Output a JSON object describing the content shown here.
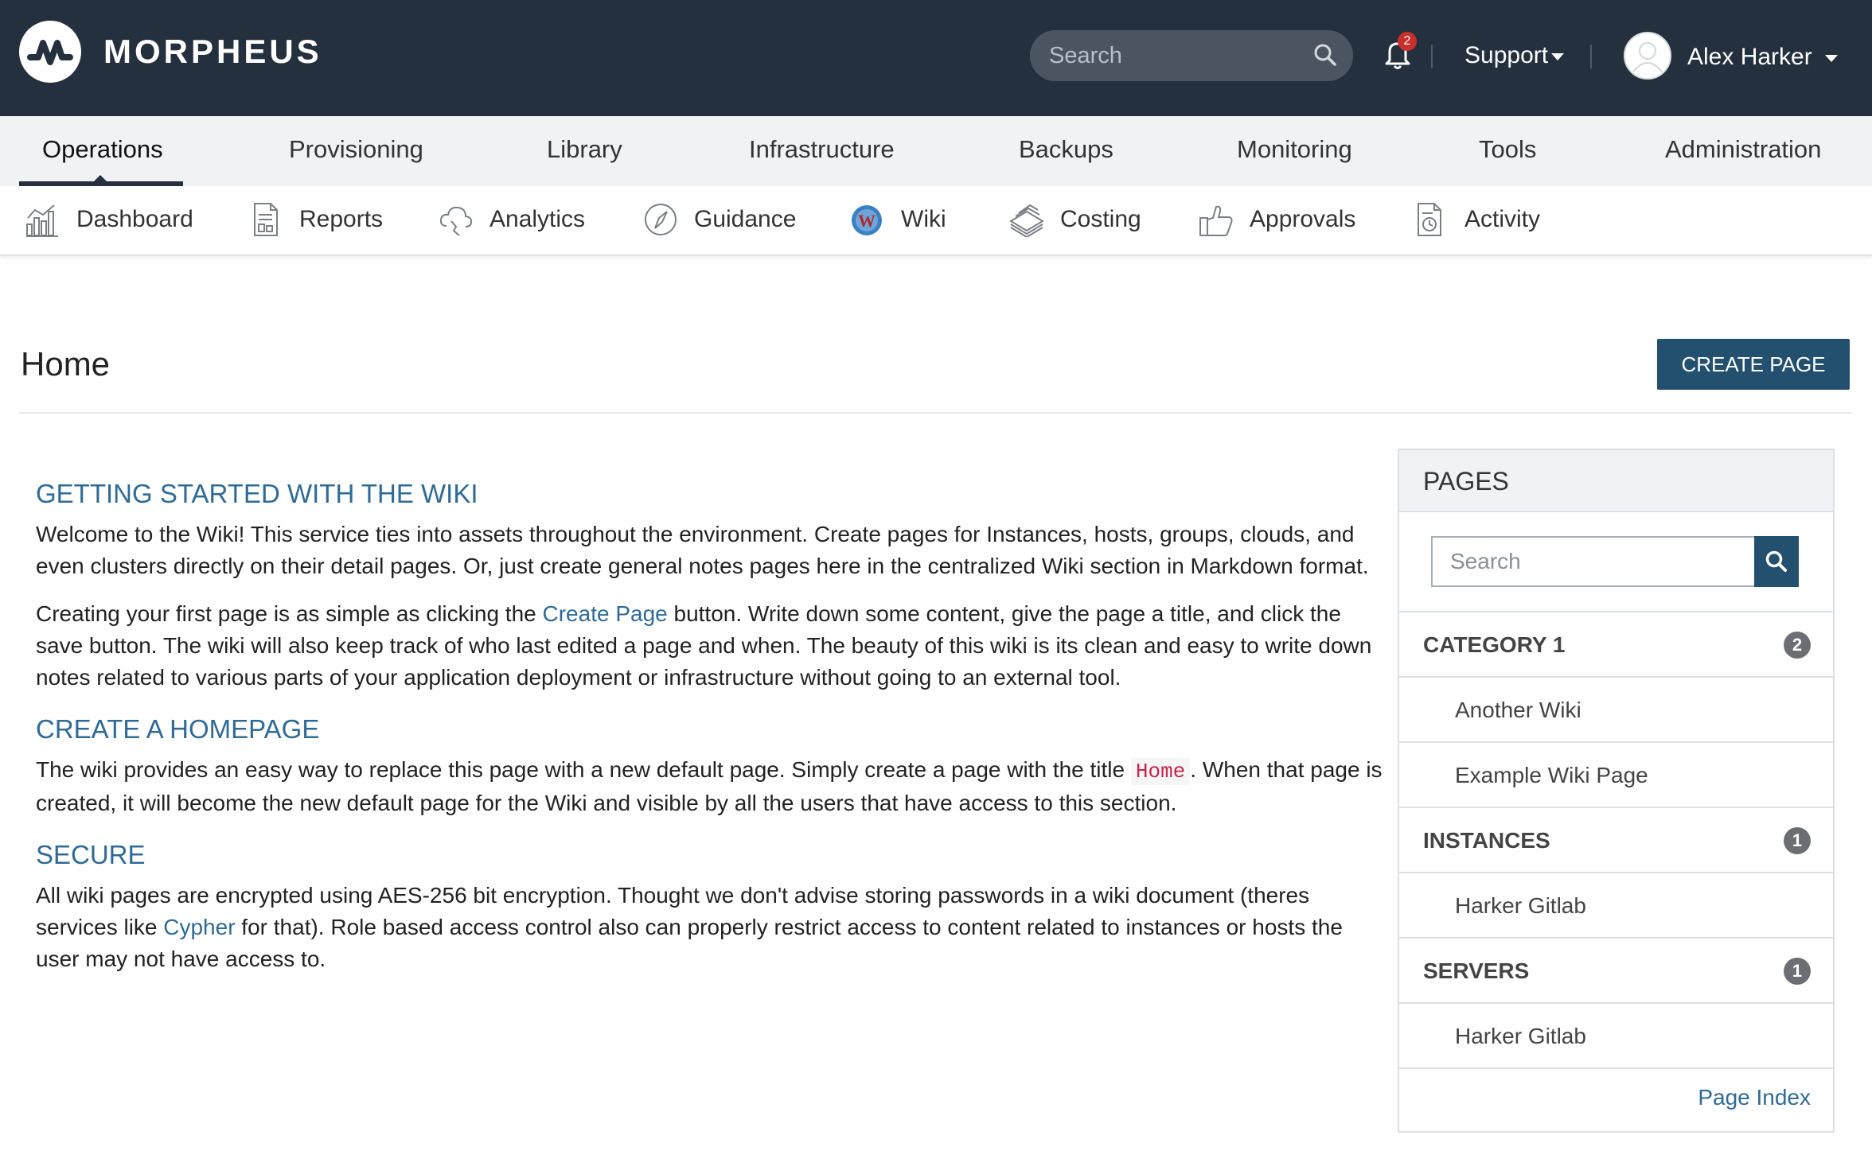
{
  "topbar": {
    "brand": "MORPHEUS",
    "search_placeholder": "Search",
    "notification_count": "2",
    "support_label": "Support",
    "user_name": "Alex Harker",
    "background_color": "#25303f"
  },
  "main_nav": {
    "active": "Operations",
    "tabs": [
      {
        "label": "Operations"
      },
      {
        "label": "Provisioning"
      },
      {
        "label": "Library"
      },
      {
        "label": "Infrastructure"
      },
      {
        "label": "Backups"
      },
      {
        "label": "Monitoring"
      },
      {
        "label": "Tools"
      },
      {
        "label": "Administration"
      }
    ]
  },
  "sub_nav": {
    "active": "Wiki",
    "items": [
      {
        "label": "Dashboard",
        "icon": "chart-bar-icon"
      },
      {
        "label": "Reports",
        "icon": "report-document-icon"
      },
      {
        "label": "Analytics",
        "icon": "cloud-analytics-icon"
      },
      {
        "label": "Guidance",
        "icon": "compass-icon"
      },
      {
        "label": "Wiki",
        "icon": "wiki-w-icon"
      },
      {
        "label": "Costing",
        "icon": "money-stack-icon"
      },
      {
        "label": "Approvals",
        "icon": "thumbs-up-icon"
      },
      {
        "label": "Activity",
        "icon": "activity-clock-icon"
      }
    ]
  },
  "page": {
    "title": "Home",
    "create_button": "CREATE PAGE"
  },
  "article": {
    "s1_heading": "GETTING STARTED WITH THE WIKI",
    "s1_p1_text": "Welcome to the Wiki! This service ties into assets throughout the environment. Create pages for Instances, hosts, groups, clouds, and even clusters directly on their detail pages. Or, just create general notes pages here in the centralized Wiki section in ",
    "s1_p1_strong": "Markdown",
    "s1_p1_end": " format.",
    "s1_p2_a": "Creating your first page is as simple as clicking the ",
    "s1_p2_link": "Create Page",
    "s1_p2_b": " button. Write down some content, give the page a title, and click the save button. The wiki will also keep track of who last edited a page and when. The beauty of this wiki is its clean and easy to write down notes related to various parts of your application deployment or infrastructure without going to an external tool.",
    "s2_heading": "CREATE A HOMEPAGE",
    "s2_p_a": "The wiki provides an easy way to replace this page with a new default page. Simply create a page with the title ",
    "s2_p_code": "Home",
    "s2_p_b": ". When that page is created, it will become the new default page for the Wiki and visible by all the users that have access to this section.",
    "s3_heading": "SECURE",
    "s3_p_a": "All wiki pages are encrypted using AES-256 bit encryption. Thought we don't advise storing passwords in a wiki document (theres services like ",
    "s3_p_link": "Cypher",
    "s3_p_b": " for that). Role based access control also can properly restrict access to content related to instances or hosts the user may not have access to."
  },
  "pages_panel": {
    "title": "PAGES",
    "search_placeholder": "Search",
    "categories": [
      {
        "name": "CATEGORY 1",
        "count": "2",
        "items": [
          "Another Wiki",
          "Example Wiki Page"
        ]
      },
      {
        "name": "INSTANCES",
        "count": "1",
        "items": [
          "Harker Gitlab"
        ]
      },
      {
        "name": "SERVERS",
        "count": "1",
        "items": [
          "Harker Gitlab"
        ]
      }
    ],
    "index_link": "Page Index"
  },
  "colors": {
    "accent": "#23506f",
    "link": "#2f6b96",
    "badge": "#6b6f74",
    "notification": "#c9302c"
  }
}
